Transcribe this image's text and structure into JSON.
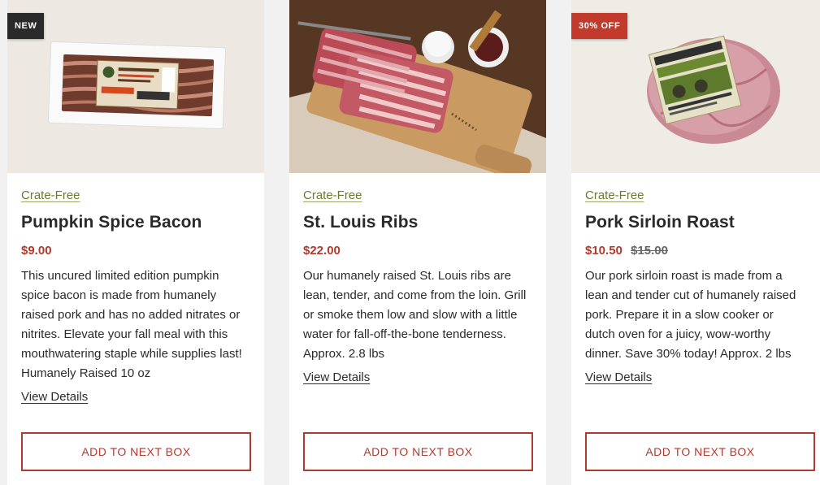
{
  "products": [
    {
      "badge": "NEW",
      "tag": "Crate-Free",
      "title": "Pumpkin Spice Bacon",
      "price": "$9.00",
      "old_price": "",
      "description": "This uncured limited edition pumpkin spice bacon is made from humanely raised pork and has no added nitrates or nitrites. Elevate your fall meal with this mouthwatering staple while supplies last!  Humanely Raised 10 oz",
      "details_label": "View Details",
      "button_label": "ADD TO NEXT BOX"
    },
    {
      "badge": "",
      "tag": "Crate-Free",
      "title": "St. Louis Ribs",
      "price": "$22.00",
      "old_price": "",
      "description": "Our humanely raised St. Louis ribs are lean, tender, and come from the loin. Grill or smoke them low and slow with a little water for fall-off-the-bone tenderness. Approx. 2.8 lbs",
      "details_label": "View Details",
      "button_label": "ADD TO NEXT BOX"
    },
    {
      "badge": "30% OFF",
      "tag": "Crate-Free",
      "title": "Pork Sirloin Roast",
      "price": "$10.50",
      "old_price": "$15.00",
      "description": "Our pork sirloin roast is made from a lean and tender cut of humanely raised pork. Prepare it in a slow cooker or dutch oven for a juicy, wow-worthy dinner. Save 30% today! Approx. 2 lbs",
      "details_label": "View Details",
      "button_label": "ADD TO NEXT BOX"
    }
  ],
  "colors": {
    "accent": "#b03a2e",
    "tag": "#6b7a2e",
    "badge_new": "#2a2a2a",
    "badge_sale": "#c23a2b"
  }
}
